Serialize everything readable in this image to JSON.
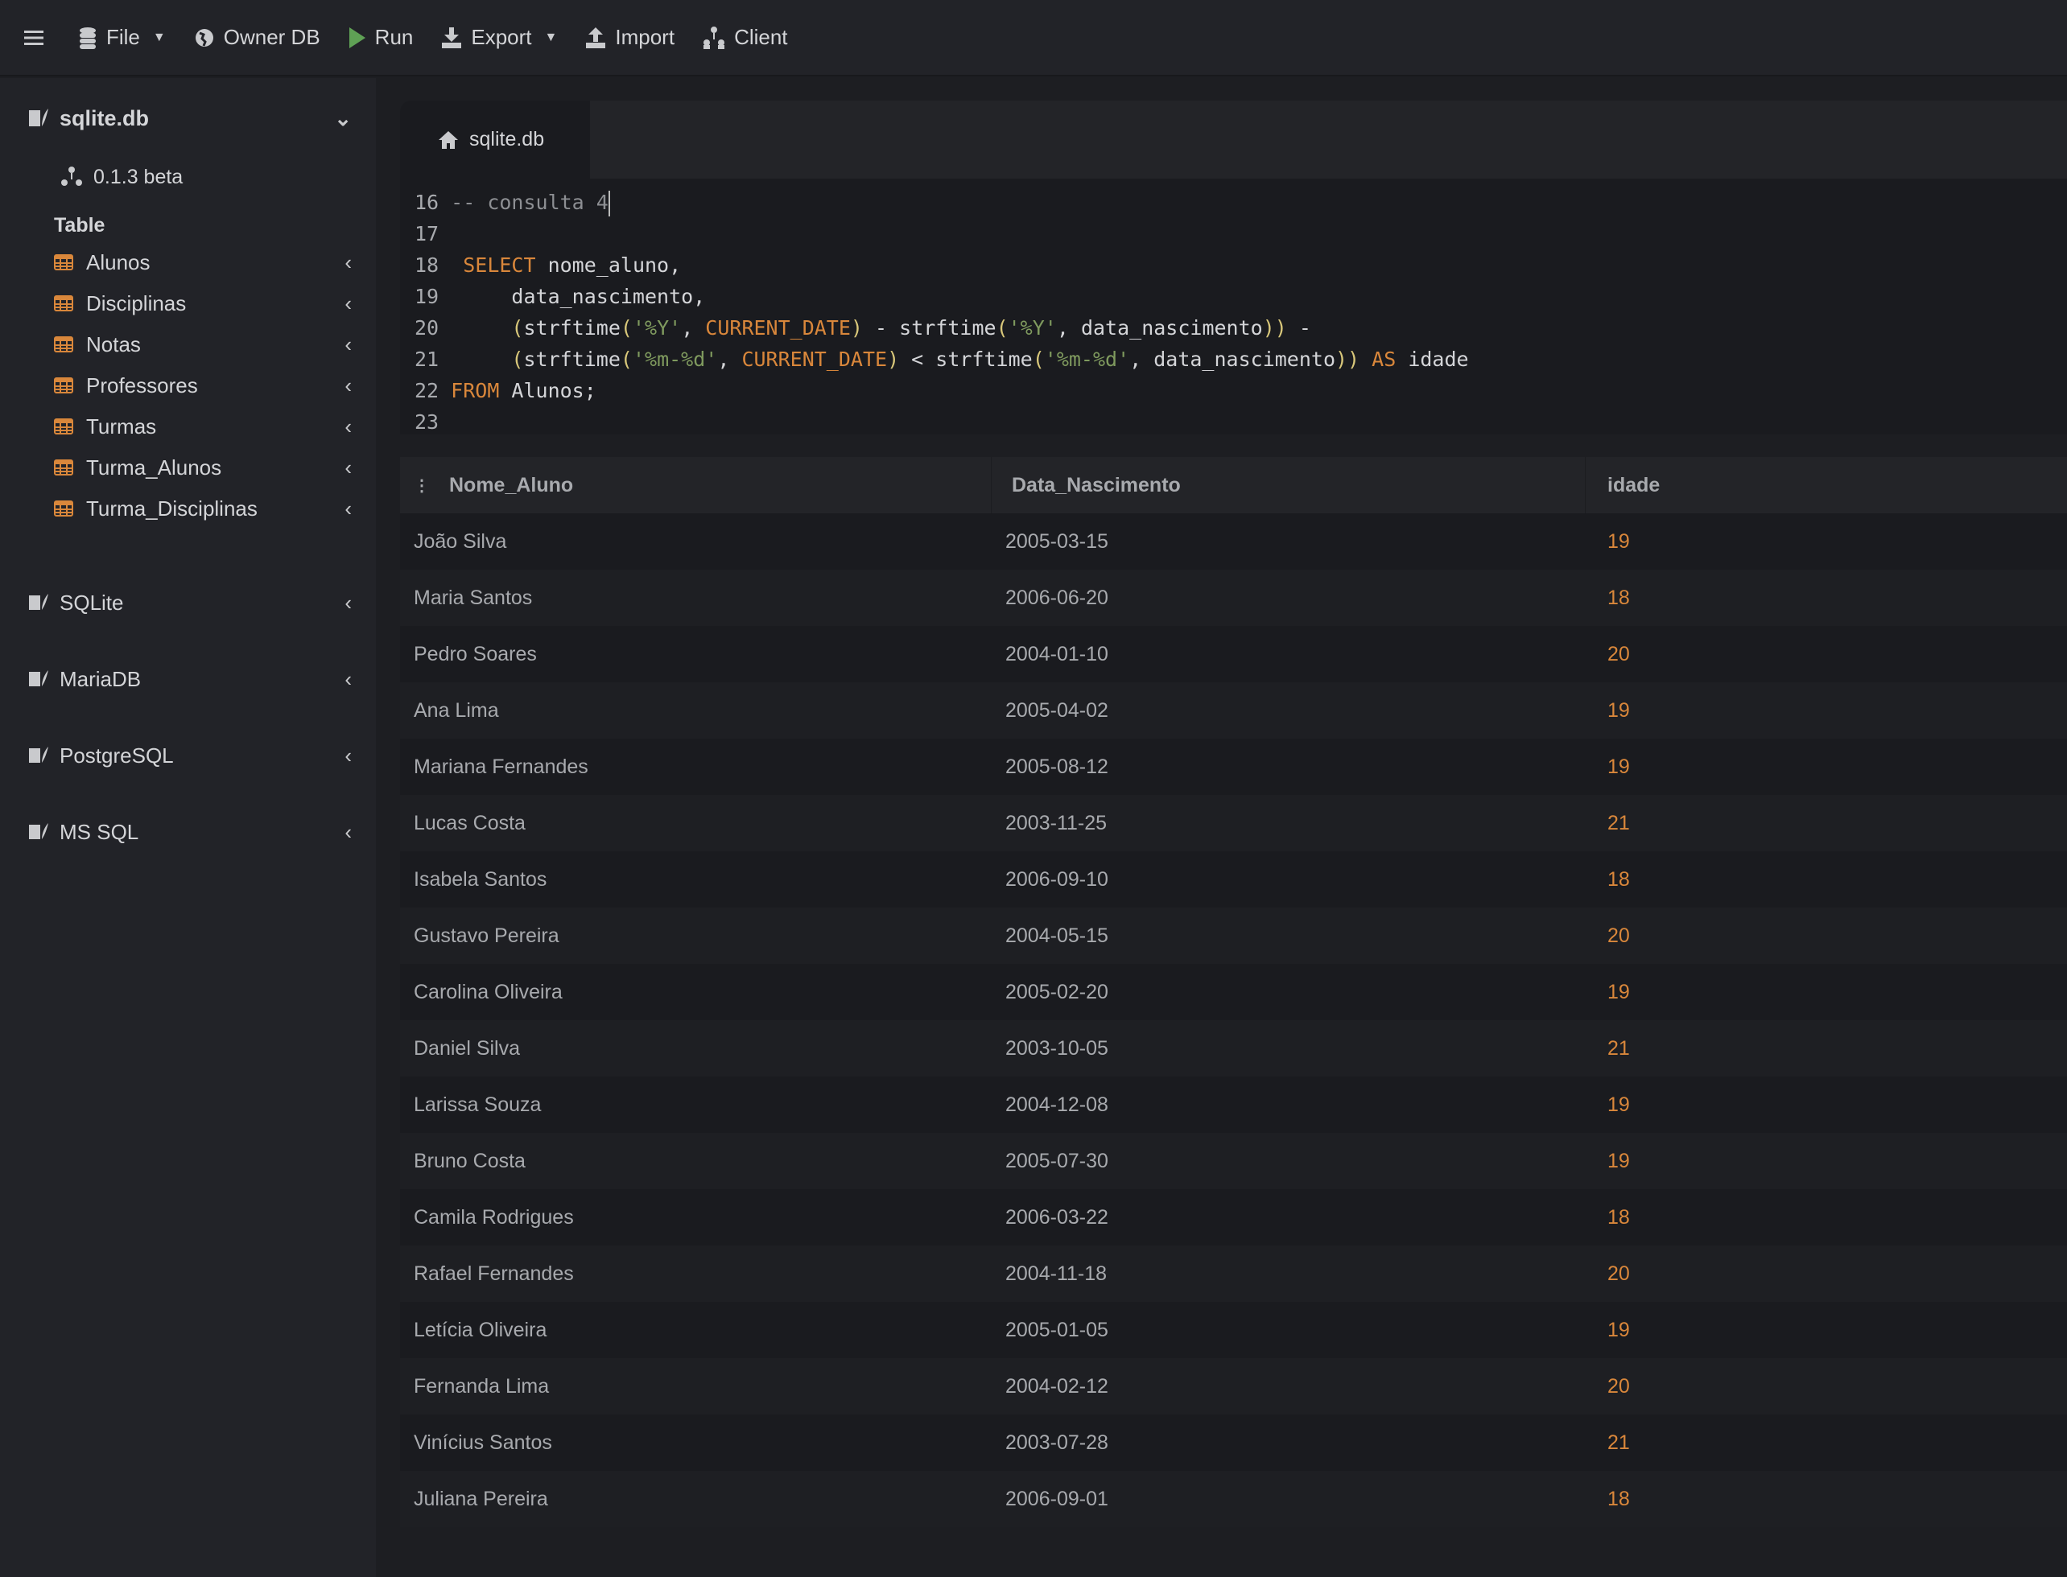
{
  "toolbar": {
    "file": "File",
    "owner_db": "Owner DB",
    "run": "Run",
    "export": "Export",
    "import": "Import",
    "client": "Client",
    "run_color": "#5fa155"
  },
  "sidebar": {
    "db_name": "sqlite.db",
    "version": "0.1.3 beta",
    "section_label": "Table",
    "tables": [
      "Alunos",
      "Disciplinas",
      "Notas",
      "Professores",
      "Turmas",
      "Turma_Alunos",
      "Turma_Disciplinas"
    ],
    "engines": [
      "SQLite",
      "MariaDB",
      "PostgreSQL",
      "MS SQL"
    ]
  },
  "tab": {
    "label": "sqlite.db"
  },
  "editor": {
    "lines": [
      {
        "no": "16",
        "segs": [
          [
            " -- consulta 4",
            "cm"
          ]
        ],
        "cursor": true
      },
      {
        "no": "17",
        "segs": []
      },
      {
        "no": "18",
        "segs": [
          [
            "  SELECT",
            "kw"
          ],
          [
            " nome_aluno,",
            ""
          ]
        ]
      },
      {
        "no": "19",
        "segs": [
          [
            "      data_nascimento,",
            ""
          ]
        ]
      },
      {
        "no": "20",
        "segs": [
          [
            "      ",
            ""
          ],
          [
            "(",
            "par"
          ],
          [
            "strftime",
            ""
          ],
          [
            "(",
            "par"
          ],
          [
            "'%Y'",
            "str"
          ],
          [
            ", ",
            ""
          ],
          [
            "CURRENT_DATE",
            "kw"
          ],
          [
            ")",
            "par"
          ],
          [
            " - strftime",
            ""
          ],
          [
            "(",
            "par"
          ],
          [
            "'%Y'",
            "str"
          ],
          [
            ", data_nascimento",
            ""
          ],
          [
            "))",
            "par"
          ],
          [
            " -",
            ""
          ]
        ]
      },
      {
        "no": "21",
        "segs": [
          [
            "      ",
            ""
          ],
          [
            "(",
            "par"
          ],
          [
            "strftime",
            ""
          ],
          [
            "(",
            "par"
          ],
          [
            "'%m-%d'",
            "str"
          ],
          [
            ", ",
            ""
          ],
          [
            "CURRENT_DATE",
            "kw"
          ],
          [
            ")",
            "par"
          ],
          [
            " < strftime",
            ""
          ],
          [
            "(",
            "par"
          ],
          [
            "'%m-%d'",
            "str"
          ],
          [
            ", data_nascimento",
            ""
          ],
          [
            "))",
            "par"
          ],
          [
            " ",
            ""
          ],
          [
            "AS",
            "kw"
          ],
          [
            " idade",
            ""
          ]
        ]
      },
      {
        "no": "22",
        "segs": [
          [
            " FROM",
            "kw"
          ],
          [
            " Alunos;",
            ""
          ]
        ]
      },
      {
        "no": "23",
        "segs": []
      }
    ]
  },
  "results": {
    "columns": [
      "Nome_Aluno",
      "Data_Nascimento",
      "idade"
    ],
    "rows": [
      [
        "João Silva",
        "2005-03-15",
        "19"
      ],
      [
        "Maria Santos",
        "2006-06-20",
        "18"
      ],
      [
        "Pedro Soares",
        "2004-01-10",
        "20"
      ],
      [
        "Ana Lima",
        "2005-04-02",
        "19"
      ],
      [
        "Mariana Fernandes",
        "2005-08-12",
        "19"
      ],
      [
        "Lucas Costa",
        "2003-11-25",
        "21"
      ],
      [
        "Isabela Santos",
        "2006-09-10",
        "18"
      ],
      [
        "Gustavo Pereira",
        "2004-05-15",
        "20"
      ],
      [
        "Carolina Oliveira",
        "2005-02-20",
        "19"
      ],
      [
        "Daniel Silva",
        "2003-10-05",
        "21"
      ],
      [
        "Larissa Souza",
        "2004-12-08",
        "19"
      ],
      [
        "Bruno Costa",
        "2005-07-30",
        "19"
      ],
      [
        "Camila Rodrigues",
        "2006-03-22",
        "18"
      ],
      [
        "Rafael Fernandes",
        "2004-11-18",
        "20"
      ],
      [
        "Letícia Oliveira",
        "2005-01-05",
        "19"
      ],
      [
        "Fernanda Lima",
        "2004-02-12",
        "20"
      ],
      [
        "Vinícius Santos",
        "2003-07-28",
        "21"
      ],
      [
        "Juliana Pereira",
        "2006-09-01",
        "18"
      ]
    ]
  }
}
